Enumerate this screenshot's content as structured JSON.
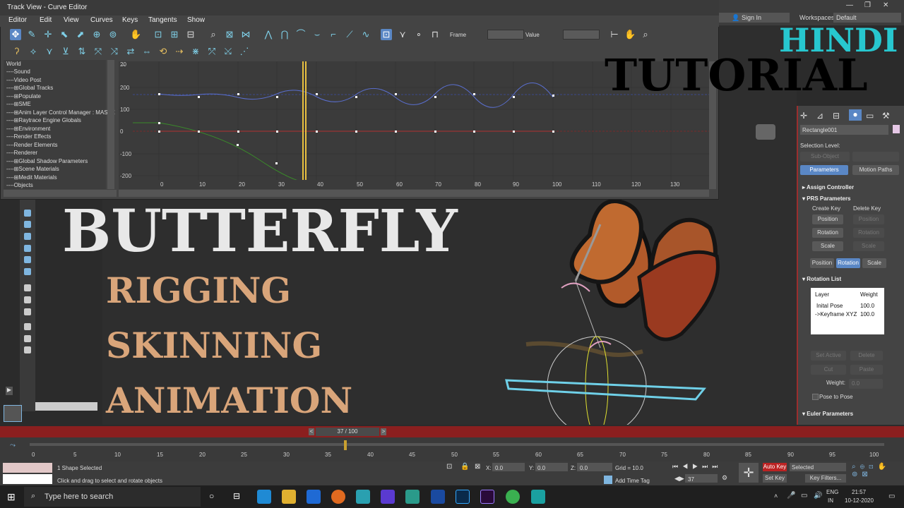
{
  "window": {
    "title": "Track View - Curve Editor",
    "menu": [
      "Editor",
      "Edit",
      "View",
      "Curves",
      "Keys",
      "Tangents",
      "Show"
    ],
    "frame_label": "Frame",
    "value_label": "Value"
  },
  "tree": {
    "items": [
      "World",
      "----Sound",
      "----Video Post",
      "----⊞Global Tracks",
      "----⊞Populate",
      "----⊞SME",
      "----⊞Anim Layer Control Manager : MASTE",
      "----⊞Raytrace Engine Globals",
      "----⊞Environment",
      "----Render Effects",
      "----Render Elements",
      "----Renderer",
      "----⊞Global Shadow Parameters",
      "----⊞Scene Materials",
      "----⊞Medit Materials",
      "----Objects"
    ]
  },
  "graph": {
    "y_ticks": [
      "200",
      "100",
      "0",
      "-100",
      "-200"
    ],
    "y_top": "2̶0",
    "x_ticks": [
      "0",
      "10",
      "20",
      "30",
      "40",
      "50",
      "60",
      "70",
      "80",
      "90",
      "100",
      "110",
      "120",
      "130"
    ]
  },
  "topbar": {
    "sign_in": "Sign In",
    "workspaces_label": "Workspaces:",
    "workspaces_value": "Default"
  },
  "overlay": {
    "hindi": "HINDI",
    "tutorial": "TUTORIAL",
    "butterfly": "BUTTERFLY",
    "rigging": "RIGGING",
    "skinning": "SKINNING",
    "animation": "ANIMATION"
  },
  "command_panel": {
    "object_name": "Rectangle001",
    "selection_level": "Selection Level:",
    "sub_object": "Sub-Object",
    "tab_parameters": "Parameters",
    "tab_motion_paths": "Motion Paths",
    "assign_controller": "Assign Controller",
    "prs_parameters": "PRS Parameters",
    "create_key": "Create Key",
    "delete_key": "Delete Key",
    "position": "Position",
    "rotation": "Rotation",
    "scale": "Scale",
    "rotation_list": "Rotation List",
    "layer_header": "Layer",
    "weight_header": "Weight",
    "layers": [
      {
        "name": "Inital Pose",
        "weight": "100.0"
      },
      {
        "name": "->Keyframe XYZ",
        "weight": "100.0"
      }
    ],
    "set_active": "Set Active",
    "delete": "Delete",
    "cut": "Cut",
    "paste": "Paste",
    "weight_label": "Weight:",
    "weight_value": "0.0",
    "pose_to_pose": "Pose to Pose",
    "euler_parameters": "Euler Parameters"
  },
  "timeline": {
    "slider": "37 / 100",
    "ticks": [
      "0",
      "5",
      "10",
      "15",
      "20",
      "25",
      "30",
      "35",
      "40",
      "45",
      "50",
      "55",
      "60",
      "65",
      "70",
      "75",
      "80",
      "85",
      "90",
      "95",
      "100"
    ]
  },
  "status": {
    "selection": "1 Shape Selected",
    "prompt": "Click and drag to select and rotate objects",
    "x_label": "X:",
    "x_value": "0.0",
    "y_label": "Y:",
    "y_value": "0.0",
    "z_label": "Z:",
    "z_value": "0.0",
    "grid": "Grid = 10.0",
    "add_time_tag": "Add Time Tag",
    "frame_value": "37",
    "auto_key": "Auto Key",
    "set_key": "Set Key",
    "selected": "Selected",
    "key_filters": "Key Filters..."
  },
  "taskbar": {
    "search_placeholder": "Type here to search",
    "lang": "ENG",
    "region": "IN",
    "time": "21:57",
    "date": "10-12-2020"
  },
  "colors": {
    "accent_blue": "#5a87c5",
    "timeline_red": "#8b1f1f",
    "hindi_cyan": "#27c7cf",
    "subtitle_tan": "#d9a57a"
  }
}
